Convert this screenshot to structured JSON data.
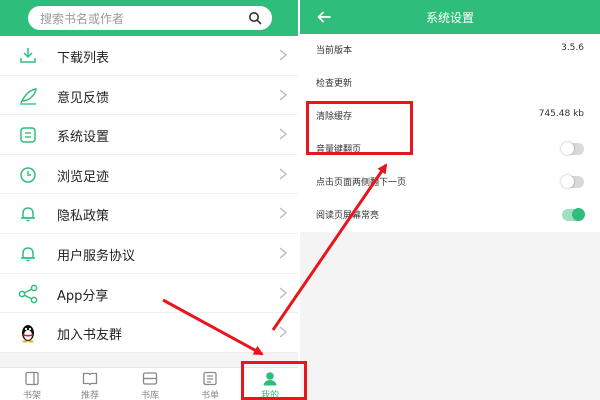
{
  "left": {
    "search": {
      "placeholder": "搜索书名或作者",
      "icon": "search-icon"
    },
    "menu": [
      {
        "label": "下载列表",
        "icon": "download-icon"
      },
      {
        "label": "意见反馈",
        "icon": "feather-icon"
      },
      {
        "label": "系统设置",
        "icon": "settings-icon"
      },
      {
        "label": "浏览足迹",
        "icon": "clock-icon"
      },
      {
        "label": "隐私政策",
        "icon": "bell-icon"
      },
      {
        "label": "用户服务协议",
        "icon": "bell-icon"
      },
      {
        "label": "App分享",
        "icon": "share-icon"
      },
      {
        "label": "加入书友群",
        "icon": "qq-penguin-icon"
      }
    ],
    "tabs": [
      {
        "label": "书架",
        "icon": "bookshelf-icon",
        "active": false
      },
      {
        "label": "推荐",
        "icon": "open-book-icon",
        "active": false
      },
      {
        "label": "书库",
        "icon": "library-icon",
        "active": false
      },
      {
        "label": "书单",
        "icon": "booklist-icon",
        "active": false
      },
      {
        "label": "我的",
        "icon": "user-icon",
        "active": true
      }
    ]
  },
  "right": {
    "title": "系统设置",
    "settings": [
      {
        "label": "当前版本",
        "value": "3.5.6"
      },
      {
        "label": "检查更新",
        "value": ""
      },
      {
        "label": "清除缓存",
        "value": "745.48 kb"
      },
      {
        "label": "音量键翻页",
        "toggle": false
      },
      {
        "label": "点击页面两侧翻下一页",
        "toggle": false
      },
      {
        "label": "阅读页屏幕常亮",
        "toggle": true
      }
    ]
  },
  "colors": {
    "accent": "#2fbd7c",
    "annotation": "#e8151c"
  }
}
